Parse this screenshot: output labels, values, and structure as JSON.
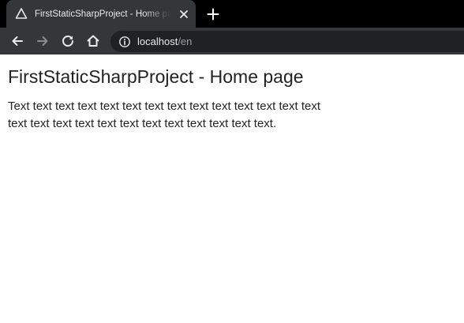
{
  "browser": {
    "tab": {
      "title": "FirstStaticSharpProject - Home page",
      "favicon": "triangle-icon"
    },
    "icons": {
      "close": "close-icon",
      "new_tab": "plus-icon",
      "back": "arrow-left-icon",
      "forward": "arrow-right-icon",
      "reload": "reload-icon",
      "home": "home-icon",
      "site_info": "info-icon"
    },
    "address_bar": {
      "host": "localhost",
      "path": "/en"
    },
    "colors": {
      "tabstrip": "#000000",
      "toolbar": "#35363a",
      "omnibox": "#202124",
      "text_light": "#e8eaed",
      "text_dim": "#9aa0a6"
    }
  },
  "page": {
    "heading": "FirstStaticSharpProject - Home page",
    "paragraph": "Text text text text text text text text text text text text text text text text text text text text text text text text text text."
  }
}
